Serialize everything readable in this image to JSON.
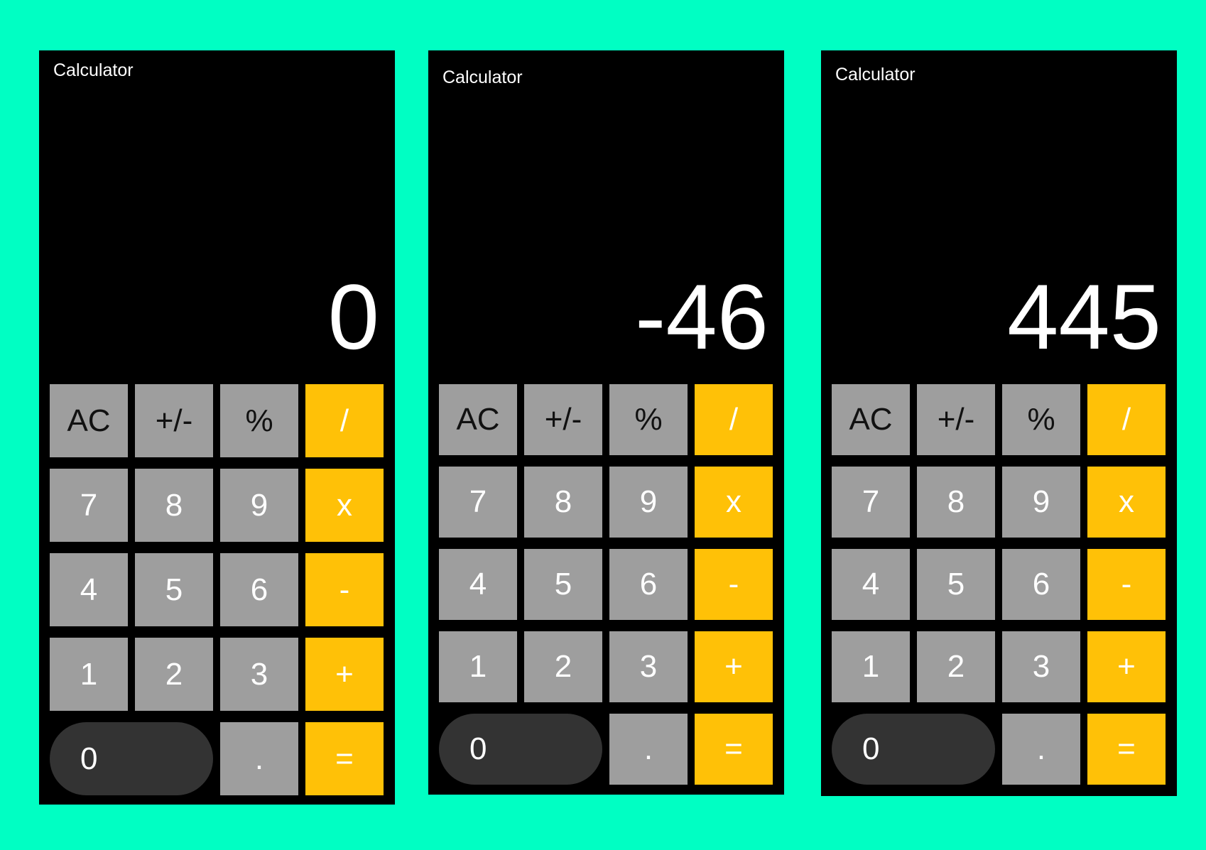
{
  "colors": {
    "background": "#00FFC3",
    "panel": "#000000",
    "key_gray": "#9E9E9E",
    "key_operator": "#FFC107",
    "key_zero": "#333333"
  },
  "calculators": [
    {
      "title": "Calculator",
      "display": "0"
    },
    {
      "title": "Calculator",
      "display": "-46"
    },
    {
      "title": "Calculator",
      "display": "445"
    }
  ],
  "keys": [
    "AC",
    "+/-",
    "%",
    "/",
    "7",
    "8",
    "9",
    "x",
    "4",
    "5",
    "6",
    "-",
    "1",
    "2",
    "3",
    "+",
    "0",
    ".",
    "="
  ]
}
